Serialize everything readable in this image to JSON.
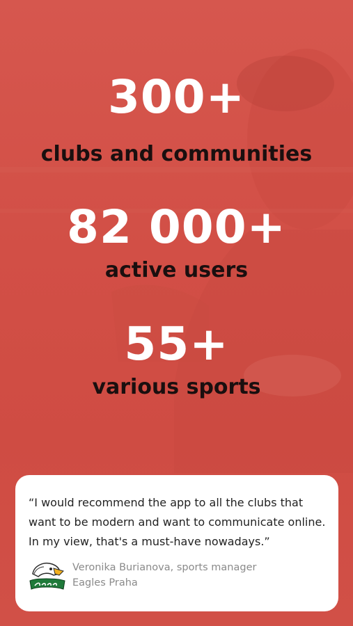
{
  "stats": [
    {
      "value": "300+",
      "label": "clubs and communities"
    },
    {
      "value": "82 000+",
      "label": "active users"
    },
    {
      "value": "55+",
      "label": "various sports"
    }
  ],
  "testimonial": {
    "quote": "“I would recommend the app to all the clubs that want to be modern and want to communicate online. In my view, that's a must-have nowadays.”",
    "author": "Veronika Burianova, sports manager",
    "organization": "Eagles Praha",
    "logo_icon": "eagles-logo"
  },
  "colors": {
    "background": "#d4534a",
    "stat_value": "#ffffff",
    "stat_label": "#1a0f0f",
    "card": "#ffffff",
    "author_text": "#8a8a8a"
  }
}
